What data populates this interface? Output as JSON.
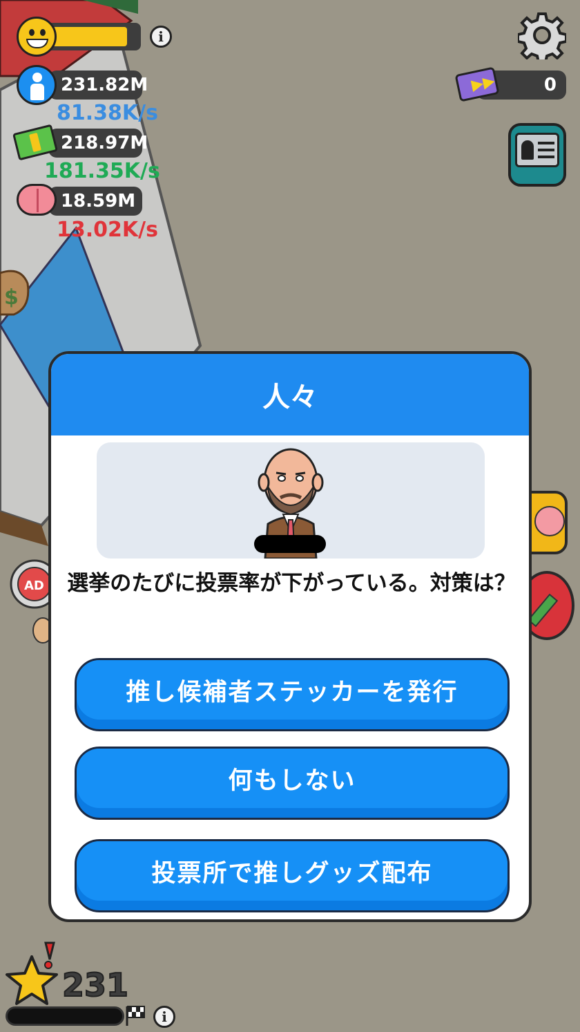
{
  "hud": {
    "happiness_level": 0.9,
    "population": {
      "value": "231.82M",
      "rate": "81.38K/s"
    },
    "money": {
      "value": "218.97M",
      "rate": "181.35K/s"
    },
    "brain": {
      "value": "18.59M",
      "rate": "13.02K/s"
    },
    "tickets": "0",
    "level": "231",
    "level_progress": 0
  },
  "dialog": {
    "title": "人々",
    "question": "選挙のたびに投票率が下がっている。対策は？",
    "choices": [
      {
        "label": "推し候補者ステッカーを発行"
      },
      {
        "label": "何もしない"
      },
      {
        "label": "投票所で推しグッズ配布"
      }
    ]
  },
  "colors": {
    "population_rate": "#3a8de0",
    "money_rate": "#1faa55",
    "brain_rate": "#e0343a",
    "dialog_header": "#1f8bf0",
    "button": "#1690f6"
  },
  "icons": {
    "happiness": "smiley-icon",
    "population": "person-icon",
    "money": "cash-icon",
    "brain": "brain-icon",
    "settings": "gear-icon",
    "ticket": "fast-forward-ticket-icon",
    "profile": "id-card-icon",
    "level": "star-icon"
  }
}
